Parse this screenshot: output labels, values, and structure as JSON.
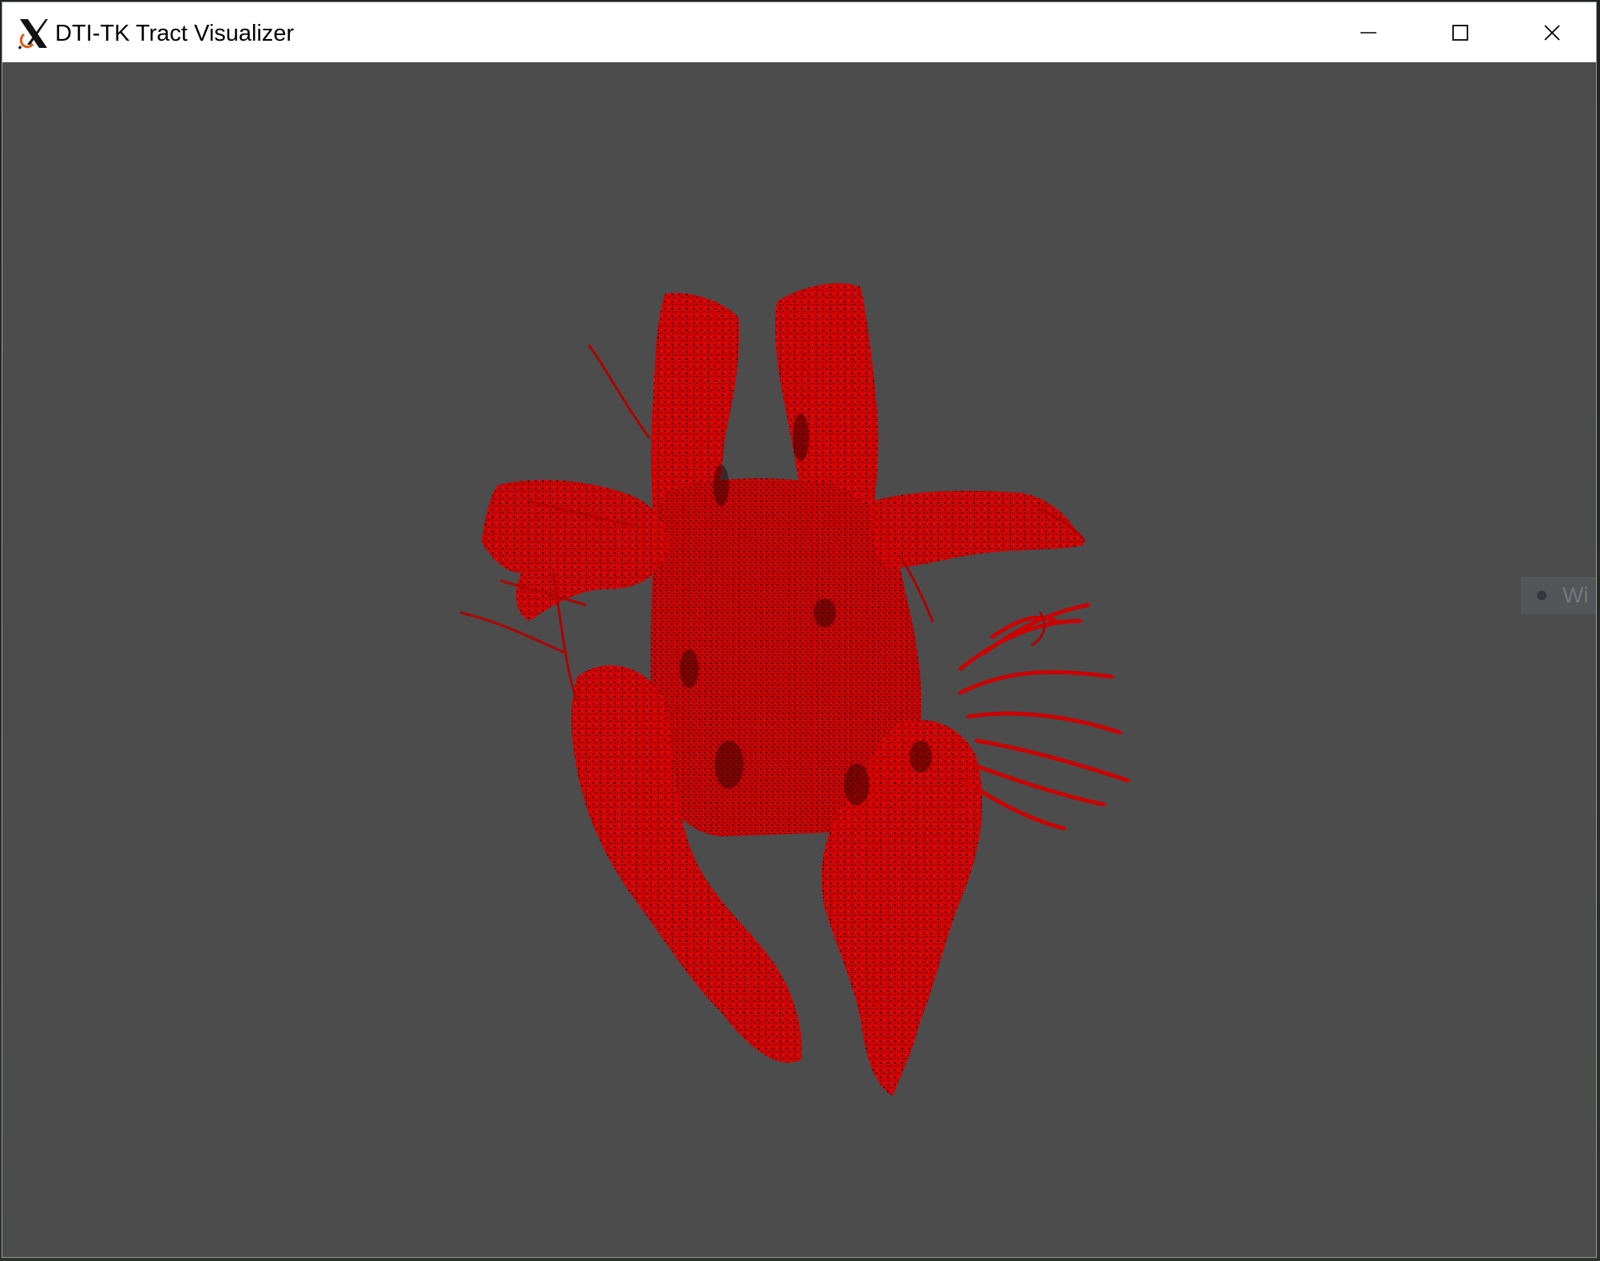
{
  "window": {
    "title": "DTI-TK Tract Visualizer",
    "app_icon": "x-window-system-icon",
    "controls": {
      "minimize_icon": "minimize-icon",
      "maximize_icon": "maximize-icon",
      "close_icon": "close-icon"
    }
  },
  "viewport": {
    "background_color": "#4c4c4c",
    "tract_color": "#dd0000",
    "content": "fiber-tractography-render"
  },
  "background_hint": {
    "text": "Wi"
  }
}
